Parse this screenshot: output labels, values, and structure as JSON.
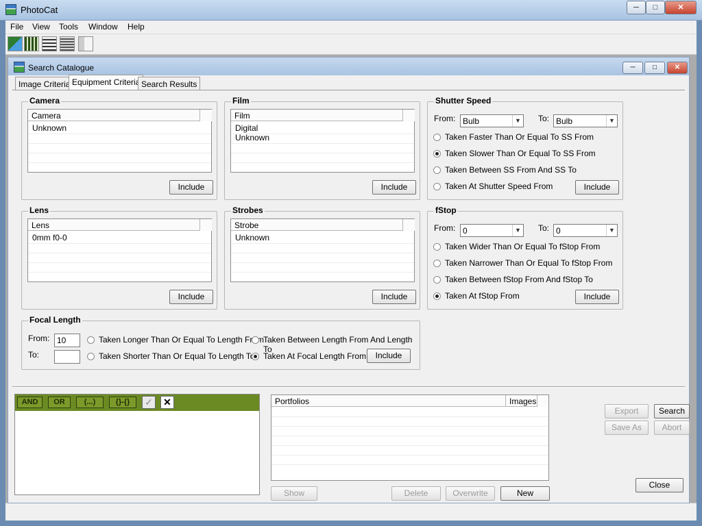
{
  "app": {
    "title": "PhotoCat",
    "window_controls": [
      "─",
      "□",
      "✕"
    ]
  },
  "menu": [
    "File",
    "View",
    "Tools",
    "Window",
    "Help"
  ],
  "toolbar": {
    "icons": [
      "image-catalogue-icon",
      "grid-view-icon",
      "list-view-icon",
      "documents-icon",
      "disabled-page-icon"
    ]
  },
  "child": {
    "title": "Search Catalogue"
  },
  "tabs": [
    {
      "label": "Image Criteria"
    },
    {
      "label": "Equipment Criteria"
    },
    {
      "label": "Search Results"
    }
  ],
  "camera": {
    "title": "Camera",
    "column": "Camera",
    "rows": [
      "Unknown"
    ],
    "include": "Include"
  },
  "film": {
    "title": "Film",
    "column": "Film",
    "rows": [
      "Digital",
      "Unknown"
    ],
    "include": "Include"
  },
  "lens": {
    "title": "Lens",
    "column": "Lens",
    "rows": [
      "0mm f0-0"
    ],
    "include": "Include"
  },
  "strobes": {
    "title": "Strobes",
    "column": "Strobe",
    "rows": [
      "Unknown"
    ],
    "include": "Include"
  },
  "shutter": {
    "title": "Shutter Speed",
    "from_label": "From:",
    "from_value": "Bulb",
    "to_label": "To:",
    "to_value": "Bulb",
    "options": [
      "Taken Faster Than Or Equal To SS From",
      "Taken Slower Than Or Equal To SS From",
      "Taken Between SS From And SS To",
      "Taken At Shutter Speed From"
    ],
    "selected": 1,
    "include": "Include"
  },
  "fstop": {
    "title": "fStop",
    "from_label": "From:",
    "from_value": "0",
    "to_label": "To:",
    "to_value": "0",
    "options": [
      "Taken Wider Than Or Equal To fStop From",
      "Taken Narrower Than Or Equal To fStop From",
      "Taken Between fStop From And fStop To",
      "Taken At fStop From"
    ],
    "selected": 3,
    "include": "Include"
  },
  "focal": {
    "title": "Focal Length",
    "from_label": "From:",
    "from_value": "10",
    "to_label": "To:",
    "to_value": "",
    "options": [
      "Taken Longer Than Or Equal To Length From",
      "Taken Between Length From And Length To",
      "Taken Shorter Than Or Equal To Length To",
      "Taken At Focal Length From"
    ],
    "selected": 3,
    "include": "Include"
  },
  "query": {
    "buttons": [
      "AND",
      "OR",
      "(...)",
      "{}-{}"
    ],
    "check_icon": "✓",
    "clear_icon": "✕"
  },
  "portfolios": {
    "col1": "Portfolios",
    "col2": "Images",
    "show": "Show",
    "delete": "Delete",
    "overwrite": "Overwrite",
    "new": "New"
  },
  "actions": {
    "export": "Export",
    "search": "Search",
    "save_as": "Save As",
    "abort": "Abort",
    "close": "Close"
  },
  "colors": {
    "accent": "#6b8a23",
    "title": "#a9c3e2"
  }
}
